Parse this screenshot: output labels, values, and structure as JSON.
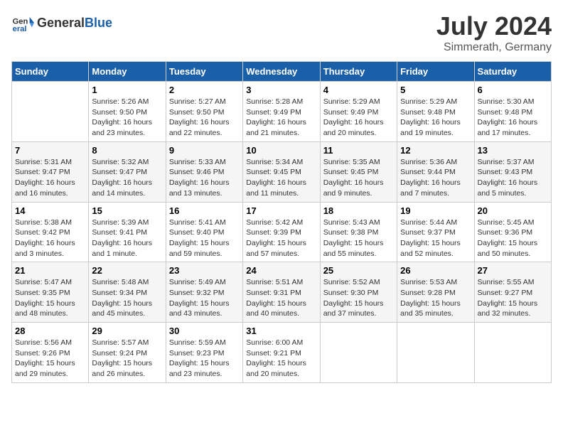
{
  "header": {
    "logo_general": "General",
    "logo_blue": "Blue",
    "month_year": "July 2024",
    "location": "Simmerath, Germany"
  },
  "weekdays": [
    "Sunday",
    "Monday",
    "Tuesday",
    "Wednesday",
    "Thursday",
    "Friday",
    "Saturday"
  ],
  "weeks": [
    [
      {
        "day": "",
        "info": ""
      },
      {
        "day": "1",
        "info": "Sunrise: 5:26 AM\nSunset: 9:50 PM\nDaylight: 16 hours\nand 23 minutes."
      },
      {
        "day": "2",
        "info": "Sunrise: 5:27 AM\nSunset: 9:50 PM\nDaylight: 16 hours\nand 22 minutes."
      },
      {
        "day": "3",
        "info": "Sunrise: 5:28 AM\nSunset: 9:49 PM\nDaylight: 16 hours\nand 21 minutes."
      },
      {
        "day": "4",
        "info": "Sunrise: 5:29 AM\nSunset: 9:49 PM\nDaylight: 16 hours\nand 20 minutes."
      },
      {
        "day": "5",
        "info": "Sunrise: 5:29 AM\nSunset: 9:48 PM\nDaylight: 16 hours\nand 19 minutes."
      },
      {
        "day": "6",
        "info": "Sunrise: 5:30 AM\nSunset: 9:48 PM\nDaylight: 16 hours\nand 17 minutes."
      }
    ],
    [
      {
        "day": "7",
        "info": "Sunrise: 5:31 AM\nSunset: 9:47 PM\nDaylight: 16 hours\nand 16 minutes."
      },
      {
        "day": "8",
        "info": "Sunrise: 5:32 AM\nSunset: 9:47 PM\nDaylight: 16 hours\nand 14 minutes."
      },
      {
        "day": "9",
        "info": "Sunrise: 5:33 AM\nSunset: 9:46 PM\nDaylight: 16 hours\nand 13 minutes."
      },
      {
        "day": "10",
        "info": "Sunrise: 5:34 AM\nSunset: 9:45 PM\nDaylight: 16 hours\nand 11 minutes."
      },
      {
        "day": "11",
        "info": "Sunrise: 5:35 AM\nSunset: 9:45 PM\nDaylight: 16 hours\nand 9 minutes."
      },
      {
        "day": "12",
        "info": "Sunrise: 5:36 AM\nSunset: 9:44 PM\nDaylight: 16 hours\nand 7 minutes."
      },
      {
        "day": "13",
        "info": "Sunrise: 5:37 AM\nSunset: 9:43 PM\nDaylight: 16 hours\nand 5 minutes."
      }
    ],
    [
      {
        "day": "14",
        "info": "Sunrise: 5:38 AM\nSunset: 9:42 PM\nDaylight: 16 hours\nand 3 minutes."
      },
      {
        "day": "15",
        "info": "Sunrise: 5:39 AM\nSunset: 9:41 PM\nDaylight: 16 hours\nand 1 minute."
      },
      {
        "day": "16",
        "info": "Sunrise: 5:41 AM\nSunset: 9:40 PM\nDaylight: 15 hours\nand 59 minutes."
      },
      {
        "day": "17",
        "info": "Sunrise: 5:42 AM\nSunset: 9:39 PM\nDaylight: 15 hours\nand 57 minutes."
      },
      {
        "day": "18",
        "info": "Sunrise: 5:43 AM\nSunset: 9:38 PM\nDaylight: 15 hours\nand 55 minutes."
      },
      {
        "day": "19",
        "info": "Sunrise: 5:44 AM\nSunset: 9:37 PM\nDaylight: 15 hours\nand 52 minutes."
      },
      {
        "day": "20",
        "info": "Sunrise: 5:45 AM\nSunset: 9:36 PM\nDaylight: 15 hours\nand 50 minutes."
      }
    ],
    [
      {
        "day": "21",
        "info": "Sunrise: 5:47 AM\nSunset: 9:35 PM\nDaylight: 15 hours\nand 48 minutes."
      },
      {
        "day": "22",
        "info": "Sunrise: 5:48 AM\nSunset: 9:34 PM\nDaylight: 15 hours\nand 45 minutes."
      },
      {
        "day": "23",
        "info": "Sunrise: 5:49 AM\nSunset: 9:32 PM\nDaylight: 15 hours\nand 43 minutes."
      },
      {
        "day": "24",
        "info": "Sunrise: 5:51 AM\nSunset: 9:31 PM\nDaylight: 15 hours\nand 40 minutes."
      },
      {
        "day": "25",
        "info": "Sunrise: 5:52 AM\nSunset: 9:30 PM\nDaylight: 15 hours\nand 37 minutes."
      },
      {
        "day": "26",
        "info": "Sunrise: 5:53 AM\nSunset: 9:28 PM\nDaylight: 15 hours\nand 35 minutes."
      },
      {
        "day": "27",
        "info": "Sunrise: 5:55 AM\nSunset: 9:27 PM\nDaylight: 15 hours\nand 32 minutes."
      }
    ],
    [
      {
        "day": "28",
        "info": "Sunrise: 5:56 AM\nSunset: 9:26 PM\nDaylight: 15 hours\nand 29 minutes."
      },
      {
        "day": "29",
        "info": "Sunrise: 5:57 AM\nSunset: 9:24 PM\nDaylight: 15 hours\nand 26 minutes."
      },
      {
        "day": "30",
        "info": "Sunrise: 5:59 AM\nSunset: 9:23 PM\nDaylight: 15 hours\nand 23 minutes."
      },
      {
        "day": "31",
        "info": "Sunrise: 6:00 AM\nSunset: 9:21 PM\nDaylight: 15 hours\nand 20 minutes."
      },
      {
        "day": "",
        "info": ""
      },
      {
        "day": "",
        "info": ""
      },
      {
        "day": "",
        "info": ""
      }
    ]
  ]
}
